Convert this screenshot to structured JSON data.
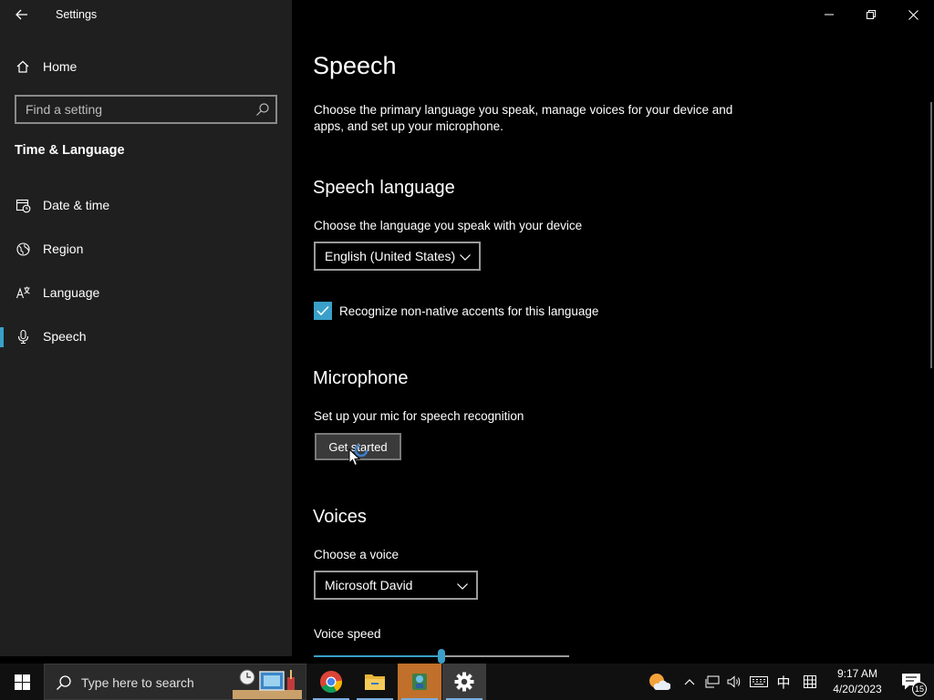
{
  "window": {
    "app_title": "Settings"
  },
  "sidebar": {
    "home_label": "Home",
    "search_placeholder": "Find a setting",
    "section_label": "Time & Language",
    "items": [
      {
        "label": "Date & time",
        "icon": "calendar-clock-icon"
      },
      {
        "label": "Region",
        "icon": "globe-icon"
      },
      {
        "label": "Language",
        "icon": "language-icon"
      },
      {
        "label": "Speech",
        "icon": "microphone-icon",
        "active": true
      }
    ]
  },
  "main": {
    "title": "Speech",
    "description": "Choose the primary language you speak, manage voices for your device and apps, and set up your microphone.",
    "speech_language": {
      "heading": "Speech language",
      "label": "Choose the language you speak with your device",
      "selected": "English (United States)",
      "checkbox_label": "Recognize non-native accents for this language",
      "checkbox_checked": true
    },
    "microphone": {
      "heading": "Microphone",
      "label": "Set up your mic for speech recognition",
      "button_label": "Get started"
    },
    "voices": {
      "heading": "Voices",
      "label": "Choose a voice",
      "selected": "Microsoft David",
      "speed_label": "Voice speed",
      "speed_fraction": 0.5
    }
  },
  "taskbar": {
    "search_text": "Type here to search",
    "apps": [
      "chrome-icon",
      "file-explorer-icon",
      "app-icon",
      "settings-icon"
    ],
    "ime_label": "中",
    "time": "9:17 AM",
    "date": "4/20/2023",
    "notification_count": "15"
  },
  "colors": {
    "accent": "#3aa0c9",
    "sidebar_bg": "#1f1f1f",
    "content_bg": "#000000",
    "taskbar_bg": "#101010"
  }
}
